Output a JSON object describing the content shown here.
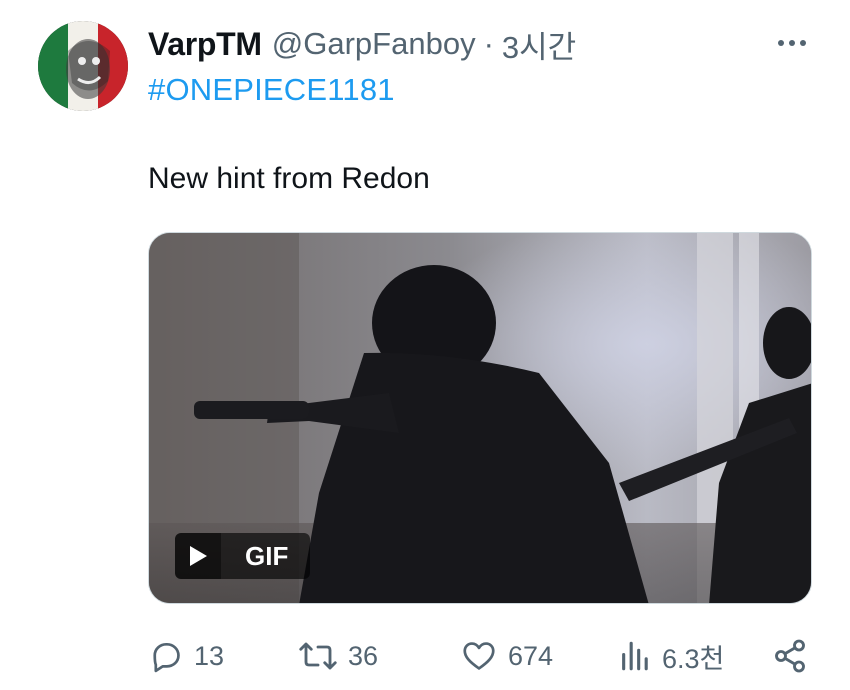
{
  "author": {
    "display_name": "VarpTM",
    "handle": "@GarpFanboy",
    "separator": "·",
    "time": "3시간"
  },
  "tweet": {
    "hashtag": "#ONEPIECE1181",
    "text": "New hint from Redon"
  },
  "media": {
    "badge_label": "GIF",
    "badge_icon": "play-icon"
  },
  "actions": {
    "reply": {
      "icon": "reply-icon",
      "count": "13"
    },
    "retweet": {
      "icon": "retweet-icon",
      "count": "36"
    },
    "like": {
      "icon": "heart-icon",
      "count": "674"
    },
    "views": {
      "icon": "views-icon",
      "count": "6.3천"
    },
    "share": {
      "icon": "share-icon"
    }
  },
  "colors": {
    "link": "#1d9bf0",
    "secondary_text": "#536471",
    "primary_text": "#0f1419",
    "border": "#cfd9de"
  }
}
